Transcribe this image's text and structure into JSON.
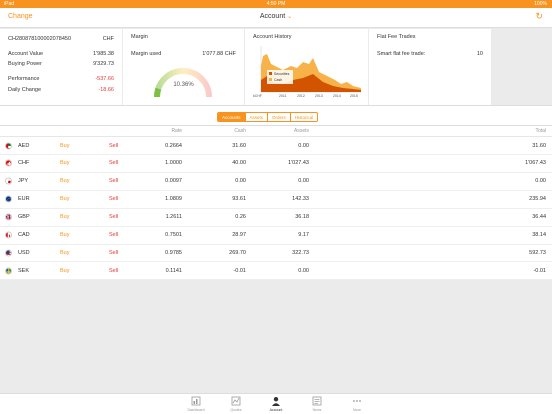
{
  "status": {
    "left": "iPad",
    "time": "4:50 PM",
    "right": "100%"
  },
  "nav": {
    "change_label": "Change",
    "title": "Account"
  },
  "account": {
    "id": "CH280878100002078450",
    "currency": "CHF",
    "rows": [
      {
        "label": "Account Value",
        "value": "1'985.38"
      },
      {
        "label": "Buying Power",
        "value": "9'329.73"
      },
      {
        "label": "Performance",
        "value": "-537.66"
      },
      {
        "label": "Daily Change",
        "value": "-18.66"
      }
    ]
  },
  "margin": {
    "title": "Margin",
    "label": "Margin used",
    "value": "1'077.88 CHF",
    "percent_text": "10.36%",
    "gauge_fraction": 0.1036,
    "gauge_color": "#7dc142"
  },
  "history": {
    "title": "Account History",
    "legend": [
      "Securities",
      "Cash"
    ],
    "x_labels": [
      "2011",
      "2012",
      "2013",
      "2014",
      "2015"
    ],
    "y_label": "kCHF",
    "colors": {
      "securities": "#d35400",
      "cash": "#f7b34a"
    }
  },
  "fees": {
    "title": "Flat Fee Trades",
    "label": "Smart flat fee trade:",
    "value": "10"
  },
  "segments": [
    "Accounts",
    "Assets",
    "Orders",
    "Historical"
  ],
  "table": {
    "headers": {
      "rate": "Rate",
      "cash": "Cash",
      "assets": "Assets",
      "total": "Total"
    },
    "buy_label": "Buy",
    "sell_label": "Sell",
    "rows": [
      {
        "cur": "AED",
        "rate": "0.2664",
        "cash": "31.60",
        "assets": "0.00",
        "total": "31.60",
        "flag": "aed"
      },
      {
        "cur": "CHF",
        "rate": "1.0000",
        "cash": "40.00",
        "assets": "1'027.43",
        "total": "1'067.43",
        "flag": "chf"
      },
      {
        "cur": "JPY",
        "rate": "0.0097",
        "cash": "0.00",
        "assets": "0.00",
        "total": "0.00",
        "flag": "jpy"
      },
      {
        "cur": "EUR",
        "rate": "1.0809",
        "cash": "93.61",
        "assets": "142.33",
        "total": "235.94",
        "flag": "eur"
      },
      {
        "cur": "GBP",
        "rate": "1.2611",
        "cash": "0.26",
        "assets": "36.18",
        "total": "36.44",
        "flag": "gbp"
      },
      {
        "cur": "CAD",
        "rate": "0.7501",
        "cash": "28.97",
        "assets": "9.17",
        "total": "38.14",
        "flag": "cad"
      },
      {
        "cur": "USD",
        "rate": "0.9785",
        "cash": "269.70",
        "assets": "322.73",
        "total": "592.73",
        "flag": "usd"
      },
      {
        "cur": "SEK",
        "rate": "0.1141",
        "cash": "-0.01",
        "assets": "0.00",
        "total": "-0.01",
        "flag": "sek"
      }
    ]
  },
  "tabbar": [
    {
      "label": "Dashboard",
      "icon": "dashboard-icon"
    },
    {
      "label": "Quotes",
      "icon": "quotes-icon"
    },
    {
      "label": "Account",
      "icon": "account-icon",
      "active": true
    },
    {
      "label": "News",
      "icon": "news-icon"
    },
    {
      "label": "More",
      "icon": "more-icon"
    }
  ]
}
